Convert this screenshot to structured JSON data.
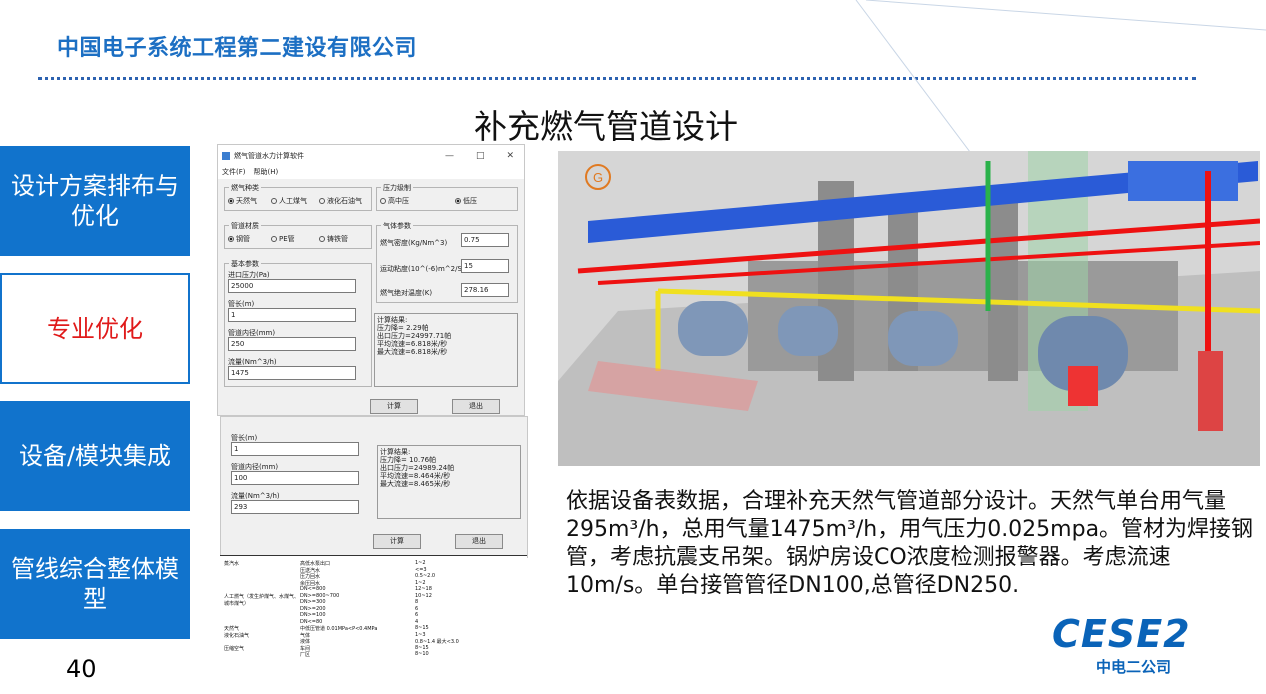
{
  "header": {
    "company": "中国电子系统工程第二建设有限公司"
  },
  "slide": {
    "title": "补充燃气管道设计",
    "page_number": "40"
  },
  "nav": [
    {
      "label": "设计方案排布与优化",
      "active": false
    },
    {
      "label": "专业优化",
      "active": true
    },
    {
      "label": "设备/模块集成",
      "active": false
    },
    {
      "label": "管线综合整体模型",
      "active": false
    }
  ],
  "software": {
    "window_title": "燃气管道水力计算软件",
    "menu": [
      "文件(F)",
      "帮助(H)"
    ],
    "gas_type": {
      "title": "燃气种类",
      "options": [
        "天然气",
        "人工煤气",
        "液化石油气"
      ],
      "selected": "天然气"
    },
    "pressure_level": {
      "title": "压力级制",
      "options": [
        "高中压",
        "低压"
      ],
      "selected": "低压"
    },
    "pipe_material": {
      "title": "管道材质",
      "options": [
        "钢管",
        "PE管",
        "铸铁管"
      ],
      "selected": "钢管"
    },
    "gas_params": {
      "title": "气体参数",
      "density_label": "燃气密度(Kg/Nm^3)",
      "density": "0.75",
      "viscosity_label": "运动粘度(10^(-6)m^2/S)",
      "viscosity": "15",
      "temp_label": "燃气绝对温度(K)",
      "temp": "278.16"
    },
    "basic_params": {
      "title": "基本参数",
      "inlet_pressure_label": "进口压力(Pa)",
      "inlet_pressure": "25000",
      "length_label": "管长(m)",
      "length": "1",
      "diameter_label": "管道内径(mm)",
      "diameter": "250",
      "flow_label": "流量(Nm^3/h)",
      "flow": "1475"
    },
    "result1": "计算结果:\n压力降= 2.29帕\n出口压力=24997.71帕\n平均流速=6.818米/秒\n最大流速=6.818米/秒",
    "calc_label": "计算",
    "exit_label": "退出",
    "second": {
      "length_label": "管长(m)",
      "length": "1",
      "diameter_label": "管道内径(mm)",
      "diameter": "100",
      "flow_label": "流量(Nm^3/h)",
      "flow": "293",
      "result": "计算结果:\n压力降= 10.76帕\n出口压力=24989.24帕\n平均流速=8.464米/秒\n最大流速=8.465米/秒"
    }
  },
  "spec_table": {
    "rows": [
      [
        "蒸汽水",
        "高低水泵出口",
        "1~2"
      ],
      [
        "",
        "压送汽水",
        "<=3"
      ],
      [
        "",
        "压力回水",
        "0.5~2.0"
      ],
      [
        "",
        "余压回水",
        "1~2"
      ],
      [
        "",
        "DN<=800",
        "12~18"
      ],
      [
        "人工燃气（发生炉煤气、水煤气、城市煤气）",
        "DN>=800~700",
        "10~12"
      ],
      [
        "",
        "DN>=300",
        "8"
      ],
      [
        "",
        "DN>=200",
        "6"
      ],
      [
        "",
        "DN>=100",
        "6"
      ],
      [
        "",
        "DN<=80",
        "4"
      ],
      [
        "天然气",
        "中低压管道 0.01MPa<P<0.4MPa",
        "8~15"
      ],
      [
        "液化石油气",
        "气体",
        "1~3"
      ],
      [
        "",
        "液体",
        "0.8~1.4 最大<3.0"
      ],
      [
        "压缩空气",
        "车间",
        "8~15"
      ],
      [
        "",
        "厂区",
        "8~10"
      ]
    ]
  },
  "description": "依据设备表数据，合理补充天然气管道部分设计。天然气单台用气量295m³/h，总用气量1475m³/h，用气压力0.025mpa。管材为焊接钢管，考虑抗震支吊架。锅炉房设CO浓度检测报警器。考虑流速10m/s。单台接管管径DN100,总管径DN250.",
  "render": {
    "marker": "G"
  },
  "logo": {
    "main": "CESE2",
    "sub": "中电二公司"
  },
  "colors": {
    "brand_blue": "#1173cc",
    "active_red": "#e01a1a"
  }
}
